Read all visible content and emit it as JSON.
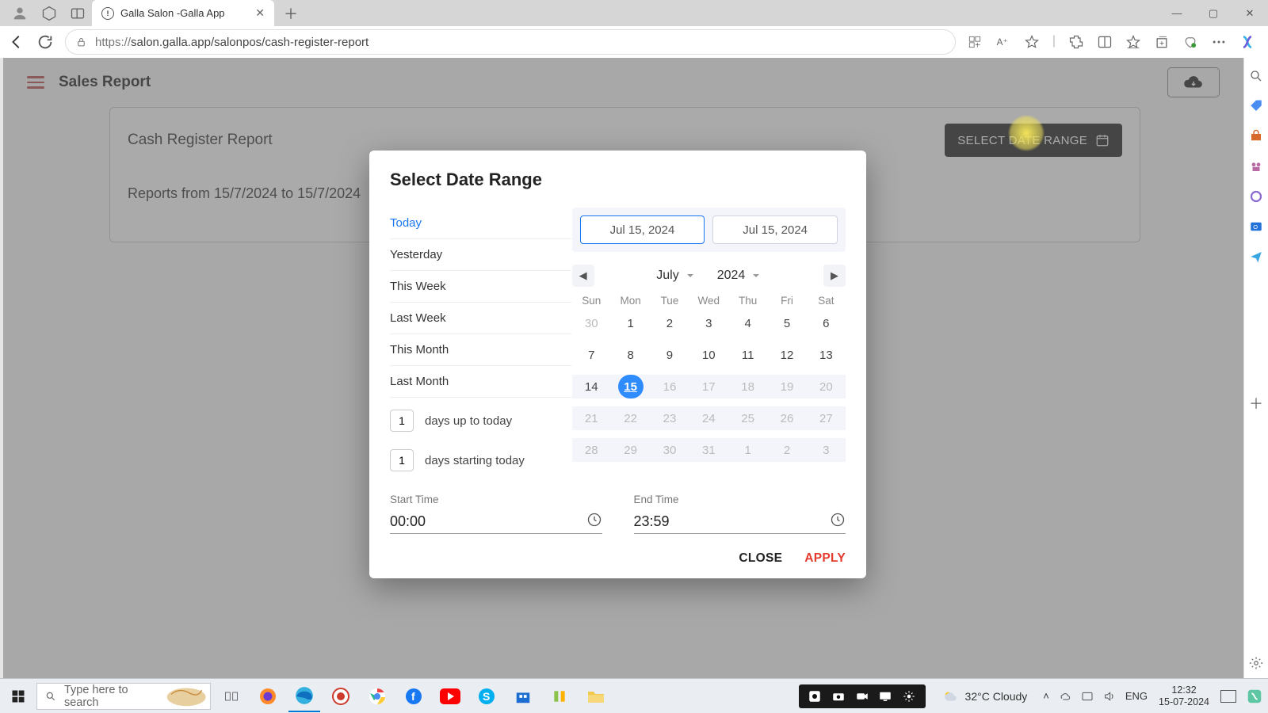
{
  "browser": {
    "tab_title": "Galla Salon -Galla App",
    "url": "https://salon.galla.app/salonpos/cash-register-report",
    "url_host_prefix": "https://",
    "url_rest": "salon.galla.app/salonpos/cash-register-report"
  },
  "app": {
    "title": "Sales Report",
    "card_title": "Cash Register Report",
    "reports_subtitle": "Reports from 15/7/2024 to 15/7/2024",
    "select_range_btn": "SELECT DATE RANGE"
  },
  "modal": {
    "title": "Select Date Range",
    "presets": [
      "Today",
      "Yesterday",
      "This Week",
      "Last Week",
      "This Month",
      "Last Month"
    ],
    "active_preset_index": 0,
    "days_up_value": "1",
    "days_up_label": "days up to today",
    "days_start_value": "1",
    "days_start_label": "days starting today",
    "start_date": "Jul 15, 2024",
    "end_date": "Jul 15, 2024",
    "month": "July",
    "year": "2024",
    "dow": [
      "Sun",
      "Mon",
      "Tue",
      "Wed",
      "Thu",
      "Fri",
      "Sat"
    ],
    "grid": [
      {
        "n": "30",
        "dim": true
      },
      {
        "n": "1"
      },
      {
        "n": "2"
      },
      {
        "n": "3"
      },
      {
        "n": "4"
      },
      {
        "n": "5"
      },
      {
        "n": "6"
      },
      {
        "n": "7"
      },
      {
        "n": "8"
      },
      {
        "n": "9"
      },
      {
        "n": "10"
      },
      {
        "n": "11"
      },
      {
        "n": "12"
      },
      {
        "n": "13"
      },
      {
        "n": "14"
      },
      {
        "n": "15",
        "selected": true
      },
      {
        "n": "16",
        "dim": true
      },
      {
        "n": "17",
        "dim": true
      },
      {
        "n": "18",
        "dim": true
      },
      {
        "n": "19",
        "dim": true
      },
      {
        "n": "20",
        "dim": true
      },
      {
        "n": "21",
        "dim": true
      },
      {
        "n": "22",
        "dim": true
      },
      {
        "n": "23",
        "dim": true
      },
      {
        "n": "24",
        "dim": true
      },
      {
        "n": "25",
        "dim": true
      },
      {
        "n": "26",
        "dim": true
      },
      {
        "n": "27",
        "dim": true
      },
      {
        "n": "28",
        "dim": true
      },
      {
        "n": "29",
        "dim": true
      },
      {
        "n": "30",
        "dim": true
      },
      {
        "n": "31",
        "dim": true
      },
      {
        "n": "1",
        "dim": true
      },
      {
        "n": "2",
        "dim": true
      },
      {
        "n": "3",
        "dim": true
      }
    ],
    "start_time_label": "Start Time",
    "start_time": "00:00",
    "end_time_label": "End Time",
    "end_time": "23:59",
    "close_btn": "CLOSE",
    "apply_btn": "APPLY"
  },
  "taskbar": {
    "search_placeholder": "Type here to search",
    "weather": "32°C  Cloudy",
    "lang": "ENG",
    "time": "12:32",
    "date": "15-07-2024"
  }
}
